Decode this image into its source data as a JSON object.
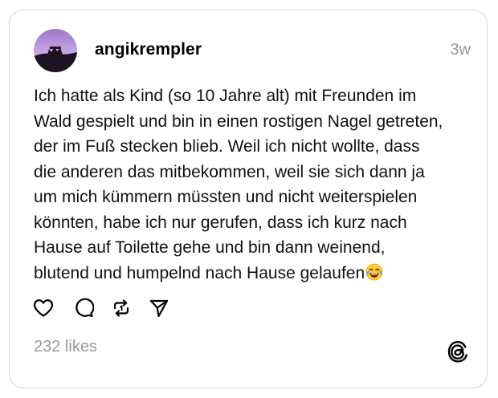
{
  "post": {
    "username": "angikrempler",
    "timestamp": "3w",
    "text_lines": [
      "Ich hatte als Kind (so 10 Jahre alt) mit Freunden im",
      "Wald gespielt und bin in einen rostigen Nagel getreten,",
      "der im Fuß stecken blieb. Weil ich nicht wollte, dass",
      "die anderen das mitbekommen, weil sie sich dann ja",
      "um mich kümmern müssten und nicht weiterspielen",
      "könnten, habe ich nur gerufen, dass ich kurz nach",
      "Hause auf Toilette gehe und bin dann weinend,",
      "blutend und humpelnd nach Hause gelaufen"
    ],
    "emoji": "face-with-tears-of-joy",
    "likes_text": "232 likes"
  },
  "actions": [
    {
      "name": "like-button",
      "icon": "heart-icon"
    },
    {
      "name": "reply-button",
      "icon": "speech-bubble-icon"
    },
    {
      "name": "repost-button",
      "icon": "repost-icon"
    },
    {
      "name": "share-button",
      "icon": "paper-plane-icon"
    }
  ],
  "brand": {
    "logo": "threads-logo-icon"
  },
  "colors": {
    "text": "#000000",
    "muted": "#999999",
    "border": "#d6d6d6",
    "background": "#ffffff"
  }
}
